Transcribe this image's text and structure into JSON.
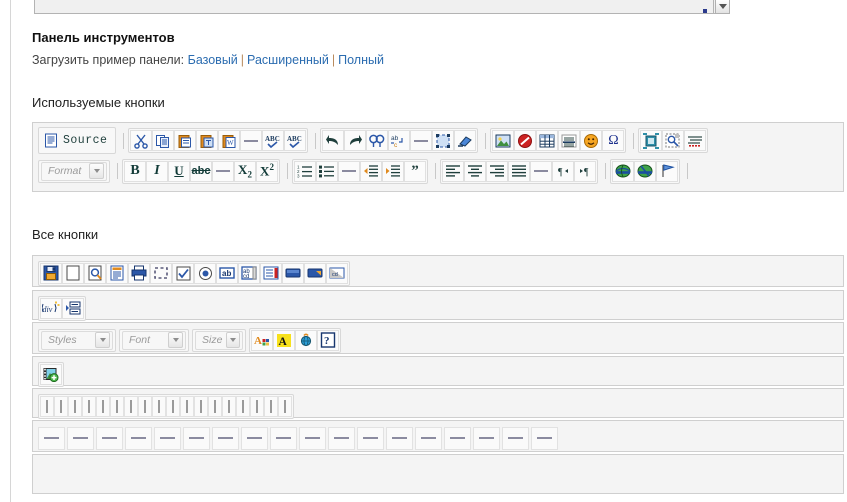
{
  "page": {
    "toolbar_heading": "Панель инструментов",
    "sample_prefix": "Загрузить пример панели:",
    "sample_links": [
      "Базовый",
      "Расширенный",
      "Полный"
    ],
    "separator_char": "|",
    "used_buttons_heading": "Используемые кнопки",
    "all_buttons_heading": "Все кнопки"
  },
  "colors": {
    "link": "#2b6cb0",
    "link_separator": "#b98b5e",
    "toolbar_bg": "#f4f4f4",
    "toolbar_border": "#cfcfcf",
    "group_bg": "#f8f8f8",
    "icon_teal": "#16504b",
    "icon_blue": "#2b57a8",
    "icon_orange": "#e08a1e"
  },
  "scrollbar": {
    "arrow_icon": "chevron-down-icon"
  },
  "used_toolbar": {
    "row1": [
      {
        "name": "source-button",
        "label": "Source",
        "type": "text"
      },
      {
        "name": "separator",
        "type": "sep"
      },
      {
        "name": "cut-icon",
        "type": "icon"
      },
      {
        "name": "copy-icon",
        "type": "icon"
      },
      {
        "name": "paste-icon",
        "type": "icon"
      },
      {
        "name": "paste-as-plain-text-icon",
        "type": "icon"
      },
      {
        "name": "paste-from-word-icon",
        "type": "icon"
      },
      {
        "name": "horizontal-rule-icon",
        "type": "hr"
      },
      {
        "name": "spell-check-icon",
        "type": "icon"
      },
      {
        "name": "spell-check-scayt-icon",
        "type": "icon"
      },
      {
        "name": "separator",
        "type": "sep"
      },
      {
        "name": "undo-icon",
        "type": "icon"
      },
      {
        "name": "redo-icon",
        "type": "icon"
      },
      {
        "name": "find-icon",
        "type": "icon"
      },
      {
        "name": "replace-icon",
        "type": "icon"
      },
      {
        "name": "horizontal-rule-icon",
        "type": "hr"
      },
      {
        "name": "select-all-icon",
        "type": "icon"
      },
      {
        "name": "remove-format-icon",
        "type": "icon"
      },
      {
        "name": "separator",
        "type": "sep"
      },
      {
        "name": "image-icon",
        "type": "icon"
      },
      {
        "name": "flash-icon",
        "type": "icon"
      },
      {
        "name": "table-icon",
        "type": "icon"
      },
      {
        "name": "horizontal-line-icon",
        "type": "icon"
      },
      {
        "name": "smiley-icon",
        "type": "icon"
      },
      {
        "name": "special-character-icon",
        "type": "icon"
      },
      {
        "name": "separator",
        "type": "sep"
      },
      {
        "name": "page-break-icon",
        "type": "icon"
      },
      {
        "name": "show-blocks-icon",
        "type": "icon"
      },
      {
        "name": "spell-check-as-you-type-icon",
        "type": "icon"
      }
    ],
    "row2": [
      {
        "name": "format-select",
        "label": "Format",
        "type": "combo"
      },
      {
        "name": "separator",
        "type": "sep"
      },
      {
        "name": "bold-icon",
        "type": "icon"
      },
      {
        "name": "italic-icon",
        "type": "icon"
      },
      {
        "name": "underline-icon",
        "type": "icon"
      },
      {
        "name": "strikethrough-icon",
        "type": "icon"
      },
      {
        "name": "horizontal-rule-icon",
        "type": "hr"
      },
      {
        "name": "subscript-icon",
        "type": "icon"
      },
      {
        "name": "superscript-icon",
        "type": "icon"
      },
      {
        "name": "separator",
        "type": "sep"
      },
      {
        "name": "numbered-list-icon",
        "type": "icon"
      },
      {
        "name": "bulleted-list-icon",
        "type": "icon"
      },
      {
        "name": "horizontal-rule-icon",
        "type": "hr"
      },
      {
        "name": "outdent-icon",
        "type": "icon"
      },
      {
        "name": "indent-icon",
        "type": "icon"
      },
      {
        "name": "blockquote-icon",
        "type": "icon"
      },
      {
        "name": "separator",
        "type": "sep"
      },
      {
        "name": "align-left-icon",
        "type": "icon"
      },
      {
        "name": "align-center-icon",
        "type": "icon"
      },
      {
        "name": "align-right-icon",
        "type": "icon"
      },
      {
        "name": "align-justify-icon",
        "type": "icon"
      },
      {
        "name": "horizontal-rule-icon",
        "type": "hr"
      },
      {
        "name": "text-direction-rtl-icon",
        "type": "icon"
      },
      {
        "name": "text-direction-ltr-icon",
        "type": "icon"
      },
      {
        "name": "separator",
        "type": "sep"
      },
      {
        "name": "link-icon",
        "type": "icon"
      },
      {
        "name": "unlink-icon",
        "type": "icon"
      },
      {
        "name": "anchor-icon",
        "type": "icon"
      },
      {
        "name": "separator",
        "type": "sep"
      }
    ]
  },
  "all_toolbar": {
    "row1": [
      {
        "name": "save-icon"
      },
      {
        "name": "new-page-icon"
      },
      {
        "name": "preview-icon"
      },
      {
        "name": "templates-icon"
      },
      {
        "name": "print-icon"
      },
      {
        "name": "select-all-icon"
      },
      {
        "name": "checkbox-icon"
      },
      {
        "name": "radio-button-icon"
      },
      {
        "name": "text-field-icon"
      },
      {
        "name": "textarea-icon"
      },
      {
        "name": "select-field-icon"
      },
      {
        "name": "button-icon"
      },
      {
        "name": "image-button-icon"
      },
      {
        "name": "hidden-field-icon"
      }
    ],
    "row2": [
      {
        "name": "create-div-icon"
      },
      {
        "name": "form-icon"
      }
    ],
    "row3": [
      {
        "name": "styles-select",
        "label": "Styles",
        "type": "combo"
      },
      {
        "name": "font-select",
        "label": "Font",
        "type": "combo"
      },
      {
        "name": "font-size-select",
        "label": "Size",
        "type": "combo"
      },
      {
        "name": "text-color-icon",
        "type": "icon"
      },
      {
        "name": "background-color-icon",
        "type": "icon"
      },
      {
        "name": "about-icon",
        "type": "icon"
      },
      {
        "name": "help-icon",
        "type": "icon"
      }
    ],
    "row4": [
      {
        "name": "add-media-icon"
      }
    ],
    "row5_separator_count": 18,
    "row6_rule_count": 18,
    "row7_empty": true
  }
}
